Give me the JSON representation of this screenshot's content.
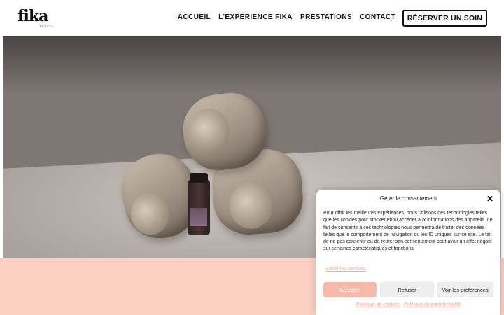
{
  "header": {
    "logo_text": "fika",
    "logo_subtext": "BEAUTY",
    "nav": [
      {
        "label": "ACCUEIL"
      },
      {
        "label": "L'EXPÉRIENCE FIKA"
      },
      {
        "label": "PRESTATIONS"
      },
      {
        "label": "CONTACT"
      }
    ],
    "cta_label": "RÉSERVER UN SOIN"
  },
  "hero": {
    "image_subject": "rolled towels with essential oil bottle on spa bed"
  },
  "consent": {
    "title": "Gérer le consentement",
    "close_icon": "close-icon",
    "body": "Pour offrir les meilleures expériences, nous utilisons des technologies telles que les cookies pour stocker et/ou accéder aux informations des appareils. Le fait de consentir à ces technologies nous permettra de traiter des données telles que le comportement de navigation ou les ID uniques sur ce site. Le fait de ne pas consentir ou de retirer son consentement peut avoir un effet négatif sur certaines caractéristiques et fonctions.",
    "manage_services": "Gérer les services",
    "accept_label": "Accepter",
    "refuse_label": "Refuser",
    "preferences_label": "Voir les préférences",
    "cookie_policy": "Politique de cookies",
    "privacy_policy": "Politique de confidentialité"
  },
  "colors": {
    "accent_pink": "#fccfc3",
    "accept_button": "#f8b8a9",
    "link_pink": "#f2a99a"
  }
}
